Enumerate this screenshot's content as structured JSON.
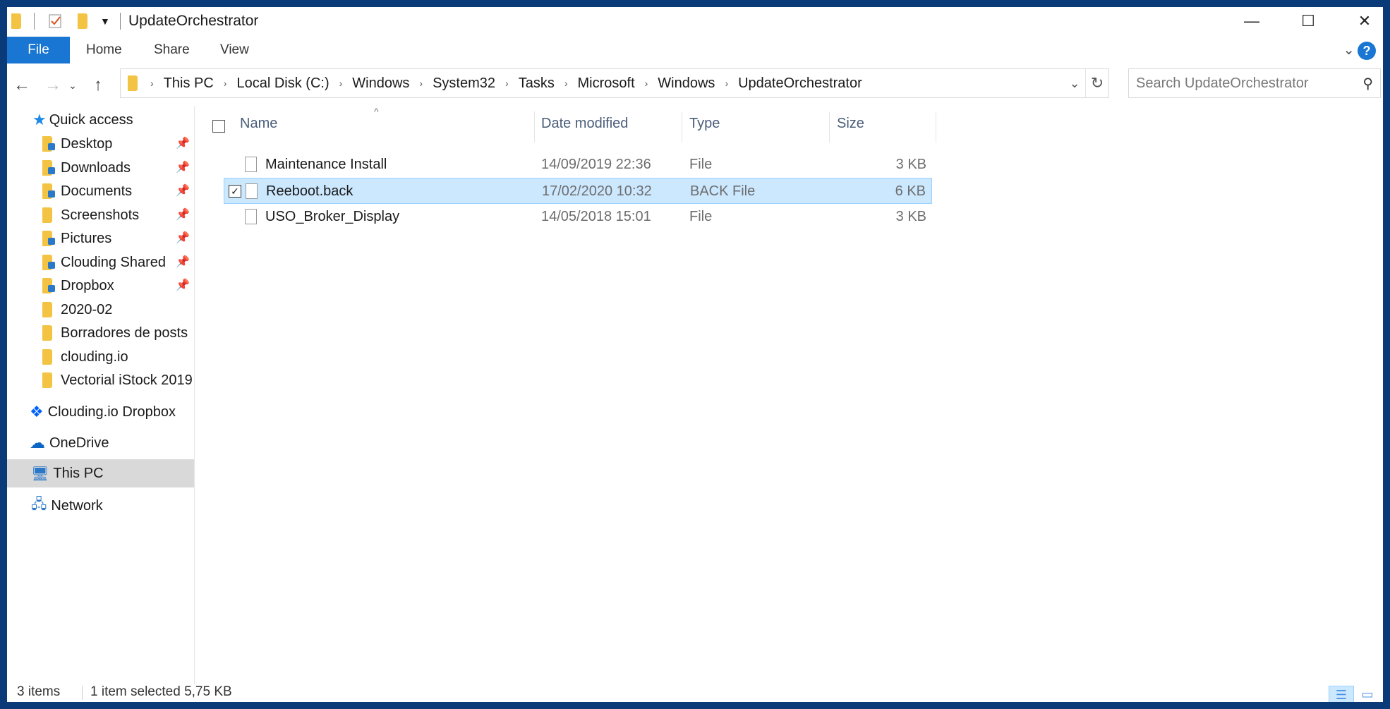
{
  "window": {
    "title": "UpdateOrchestrator"
  },
  "title_controls": {
    "minimize": "—",
    "maximize": "☐",
    "close": "✕"
  },
  "ribbon": {
    "tabs": [
      "File",
      "Home",
      "Share",
      "View"
    ],
    "help": "?"
  },
  "address_bar": {
    "path": [
      "This PC",
      "Local Disk (C:)",
      "Windows",
      "System32",
      "Tasks",
      "Microsoft",
      "Windows",
      "UpdateOrchestrator"
    ]
  },
  "search": {
    "placeholder": "Search UpdateOrchestrator"
  },
  "sidebar": {
    "quick_access": "Quick access",
    "items": [
      {
        "label": "Desktop",
        "pinned": true
      },
      {
        "label": "Downloads",
        "pinned": true
      },
      {
        "label": "Documents",
        "pinned": true
      },
      {
        "label": "Screenshots",
        "pinned": true
      },
      {
        "label": "Pictures",
        "pinned": true
      },
      {
        "label": "Clouding Shared",
        "pinned": true
      },
      {
        "label": "Dropbox",
        "pinned": true
      },
      {
        "label": "2020-02",
        "pinned": false
      },
      {
        "label": "Borradores de posts",
        "pinned": false
      },
      {
        "label": "clouding.io",
        "pinned": false
      },
      {
        "label": "Vectorial iStock 2019",
        "pinned": false
      }
    ],
    "dropbox": "Clouding.io Dropbox",
    "onedrive": "OneDrive",
    "this_pc": "This PC",
    "network": "Network"
  },
  "file_list": {
    "columns": [
      "Name",
      "Date modified",
      "Type",
      "Size"
    ],
    "rows": [
      {
        "name": "Maintenance Install",
        "date": "14/09/2019 22:36",
        "type": "File",
        "size": "3 KB",
        "selected": false
      },
      {
        "name": "Reeboot.back",
        "date": "17/02/2020 10:32",
        "type": "BACK File",
        "size": "6 KB",
        "selected": true
      },
      {
        "name": "USO_Broker_Display",
        "date": "14/05/2018 15:01",
        "type": "File",
        "size": "3 KB",
        "selected": false
      }
    ]
  },
  "status_bar": {
    "item_count": "3 items",
    "selection": "1 item selected 5,75 KB"
  },
  "colors": {
    "accent": "#1976d2",
    "selection": "#cce8ff",
    "border": "#0b3a78"
  }
}
